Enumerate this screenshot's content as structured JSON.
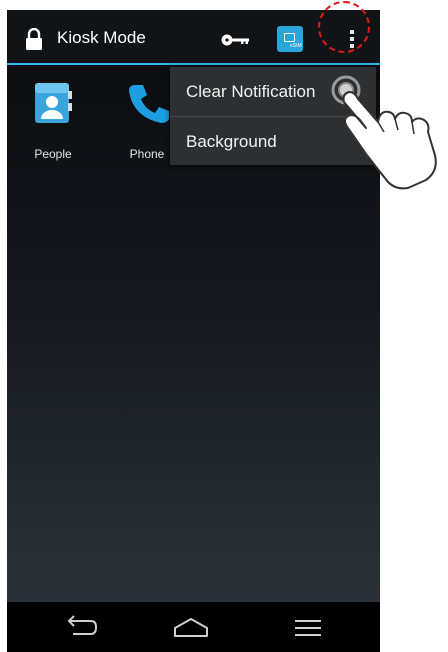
{
  "header": {
    "title": "Kiosk Mode",
    "icons": [
      "lock-icon",
      "key-icon",
      "sim-card-icon",
      "overflow-menu-icon"
    ],
    "sim_badge_text": "eSIM",
    "accent_color": "#33b5e5"
  },
  "apps": [
    {
      "label": "People",
      "icon": "people-app-icon"
    },
    {
      "label": "Phone",
      "icon": "phone-app-icon"
    }
  ],
  "menu": {
    "items": [
      {
        "label": "Clear Notification"
      },
      {
        "label": "Background"
      }
    ]
  },
  "nav": {
    "buttons": [
      "back-icon",
      "home-icon",
      "recent-apps-icon"
    ]
  },
  "annotation": {
    "highlight_color": "#e01818",
    "pointer": "hand-pointer-icon"
  }
}
